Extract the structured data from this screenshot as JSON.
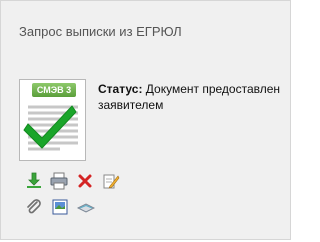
{
  "panel": {
    "title": "Запрос выписки из ЕГРЮЛ"
  },
  "document": {
    "badge_label": "СМЭВ 3",
    "badge_color": "#6bb04a",
    "check_color": "#1aa52a"
  },
  "status": {
    "label": "Статус:",
    "value": " Документ предоставлен заявителем"
  },
  "actions": {
    "row1": [
      "download-icon",
      "print-icon",
      "delete-icon",
      "edit-icon"
    ],
    "row2": [
      "attach-icon",
      "image-icon",
      "scanner-icon"
    ]
  }
}
